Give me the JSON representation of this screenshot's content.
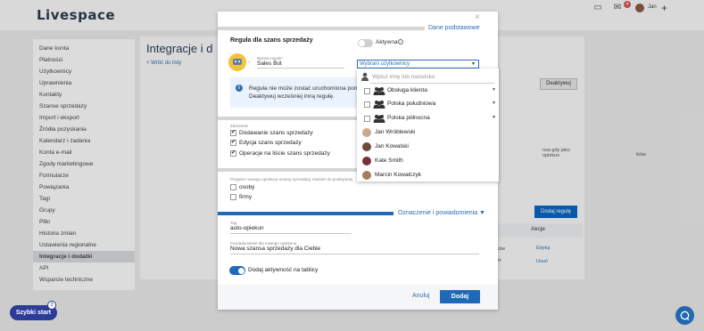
{
  "app": {
    "logo": "Livespace",
    "notif_count": "4",
    "user": "Jan",
    "plus": "+"
  },
  "sidebar": {
    "items": [
      "Dane konta",
      "Płatności",
      "Użytkownicy",
      "Uprawnienia",
      "Kontakty",
      "Szanse sprzedaży",
      "Import i eksport",
      "Źródła pozyskania",
      "Kalendarz i zadania",
      "Konta e-mail",
      "Zgody marketingowe",
      "Formularze",
      "Powiązania",
      "Tagi",
      "Grupy",
      "Pliki",
      "Historia zmian",
      "Ustawienia regionalne",
      "Integracje i dodatki",
      "API",
      "Wsparcie techniczne"
    ],
    "active_index": 18
  },
  "content": {
    "title": "Integracje i d",
    "back": "< Wróć do listy",
    "deaktywuj": "Deaktywuj",
    "gdy_text": "nsa gdy jako opiekun",
    "ikow_text": "ików",
    "dodaj_regule": "Dodaj regułę",
    "akcje": "Akcje",
    "row1": "ików",
    "row2": "ort",
    "edytuj": "Edytuj",
    "usun": "Usuń"
  },
  "quick_start": {
    "label": "Szybki start",
    "count": "3"
  },
  "modal": {
    "close": "×",
    "dane_link": "Dane podstawowe",
    "section_title": "Reguła dla szans sprzedaży",
    "aktywna_label": "Aktywna",
    "info_symbol": "i",
    "dash": "-",
    "rule_name_label": "Nazwa reguły*",
    "rule_name_value": "Sales Bot",
    "users_select": "Wybrani użytkownicy",
    "select_arrow": "▼",
    "info_line1": "Reguła nie może zostać uruchomiona poni",
    "info_line2": "Deaktywuj wcześniej inną regułę.",
    "events_label": "Zdarzenie",
    "events": [
      {
        "label": "Dodawanie szans sprzedaży",
        "checked": true
      },
      {
        "label": "Edycja szans sprzedaży",
        "checked": true
      },
      {
        "label": "Operacje na liście szans sprzedaży",
        "checked": true
      }
    ],
    "assign_label": "Przypisz nowego opiekuna szansy sprzedaży również do powiązanej",
    "assign_options": [
      {
        "label": "osoby",
        "checked": false
      },
      {
        "label": "firmy",
        "checked": false
      }
    ],
    "ozn_link": "Oznaczenie i powiadomienia ▼",
    "tag_label": "Tag",
    "tag_value": "auto-opiekun",
    "notif_label": "Powiadomienie dla nowego opiekuna",
    "notif_value": "Nowa szansa sprzedaży dla Ciebie",
    "board_label": "Dodaj aktywność na tablicy",
    "cancel": "Anuluj",
    "add": "Dodaj"
  },
  "dropdown": {
    "search_placeholder": "Wpisz imię lub nazwisko",
    "groups": [
      {
        "label": "Obsługa klienta",
        "chevron": "▼"
      },
      {
        "label": "Polska południowa",
        "chevron": "▼"
      },
      {
        "label": "Polska północna",
        "chevron": "▼"
      }
    ],
    "users": [
      {
        "label": "Jan Wróblewski",
        "color": "#c9a98e"
      },
      {
        "label": "Jan Kowalski",
        "color": "#6d4c3d"
      },
      {
        "label": "Kate Smith",
        "color": "#7a2f3b"
      },
      {
        "label": "Marcin Kowalczyk",
        "color": "#a97c5e"
      }
    ]
  },
  "colors": {
    "accent": "#1f69b8",
    "brand_dark": "#2b3b98"
  }
}
